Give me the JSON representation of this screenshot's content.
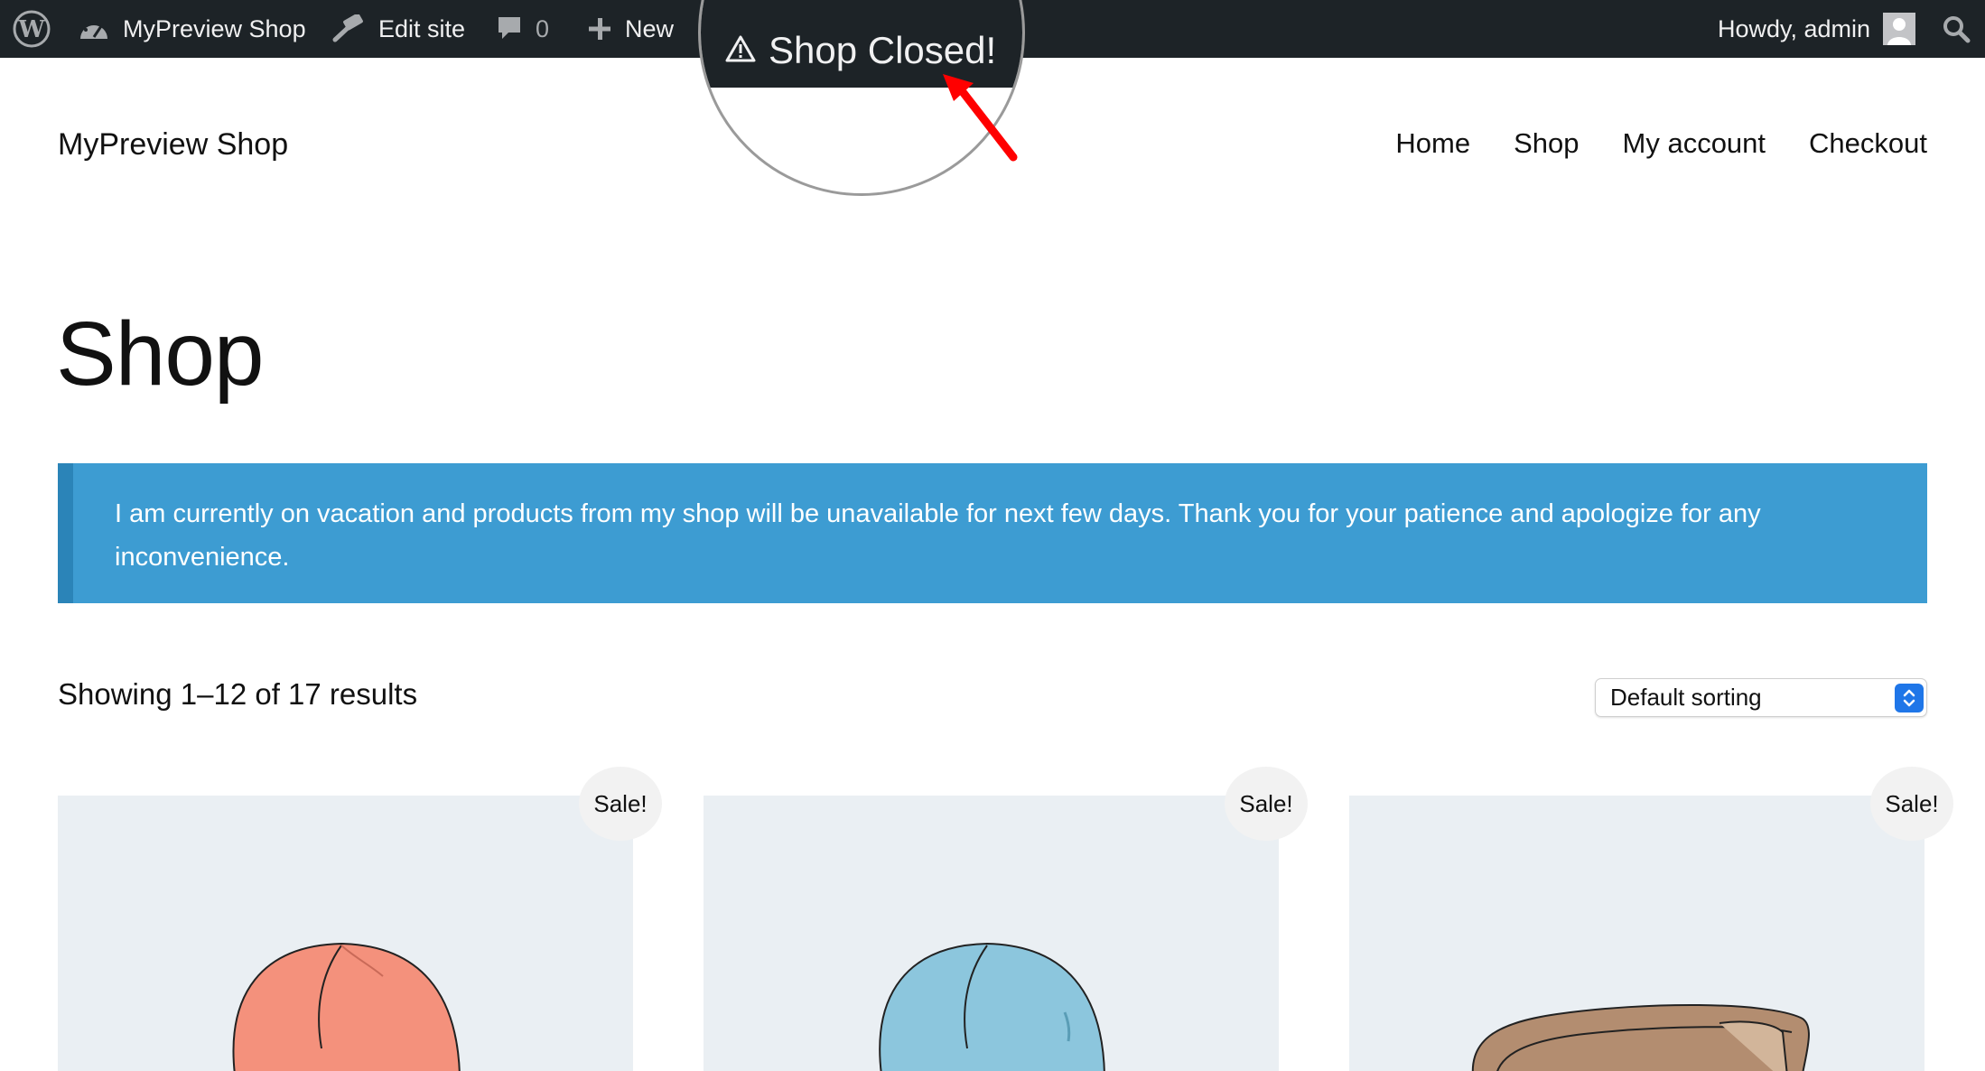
{
  "adminbar": {
    "site_name": "MyPreview Shop",
    "edit_site": "Edit site",
    "comments_count": "0",
    "new_label": "New",
    "greeting": "Howdy, admin"
  },
  "magnifier": {
    "status_label": "Shop Closed!"
  },
  "header": {
    "site_title": "MyPreview Shop",
    "nav": [
      "Home",
      "Shop",
      "My account",
      "Checkout"
    ]
  },
  "page": {
    "title": "Shop",
    "notice": "I am currently on vacation and products from my shop will be unavailable for next few days. Thank you for your patience and apologize for any inconvenience.",
    "result_count": "Showing 1–12 of 17 results",
    "sorting_selected": "Default sorting"
  },
  "products": [
    {
      "badge": "Sale!",
      "color": "#f4917c"
    },
    {
      "badge": "Sale!",
      "color": "#8cc6dd"
    },
    {
      "badge": "Sale!",
      "color": "#b38d70"
    }
  ],
  "colors": {
    "adminbar_bg": "#1d2327",
    "notice_bg": "#3d9cd2",
    "notice_border": "#2b84b8",
    "product_bg": "#eaeff3"
  }
}
